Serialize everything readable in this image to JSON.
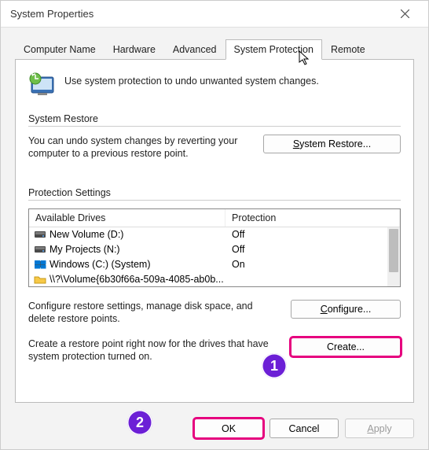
{
  "window": {
    "title": "System Properties"
  },
  "tabs": [
    {
      "label": "Computer Name"
    },
    {
      "label": "Hardware"
    },
    {
      "label": "Advanced"
    },
    {
      "label": "System Protection"
    },
    {
      "label": "Remote"
    }
  ],
  "selected_tab_index": 3,
  "intro": "Use system protection to undo unwanted system changes.",
  "restore_section": {
    "header": "System Restore",
    "text": "You can undo system changes by reverting your computer to a previous restore point.",
    "button": "System Restore..."
  },
  "protection_section": {
    "header": "Protection Settings",
    "col_drive": "Available Drives",
    "col_prot": "Protection",
    "drives": [
      {
        "icon": "hdd",
        "name": "New Volume (D:)",
        "protection": "Off"
      },
      {
        "icon": "hdd",
        "name": "My Projects (N:)",
        "protection": "Off"
      },
      {
        "icon": "win",
        "name": "Windows (C:) (System)",
        "protection": "On"
      },
      {
        "icon": "folder",
        "name": "\\\\?\\Volume{6b30f66a-509a-4085-ab0b...",
        "protection": ""
      }
    ],
    "configure_text": "Configure restore settings, manage disk space, and delete restore points.",
    "configure_btn": "Configure...",
    "create_text": "Create a restore point right now for the drives that have system protection turned on.",
    "create_btn": "Create..."
  },
  "footer": {
    "ok": "OK",
    "cancel": "Cancel",
    "apply": "Apply"
  },
  "annotations": {
    "badge1": "1",
    "badge2": "2"
  }
}
